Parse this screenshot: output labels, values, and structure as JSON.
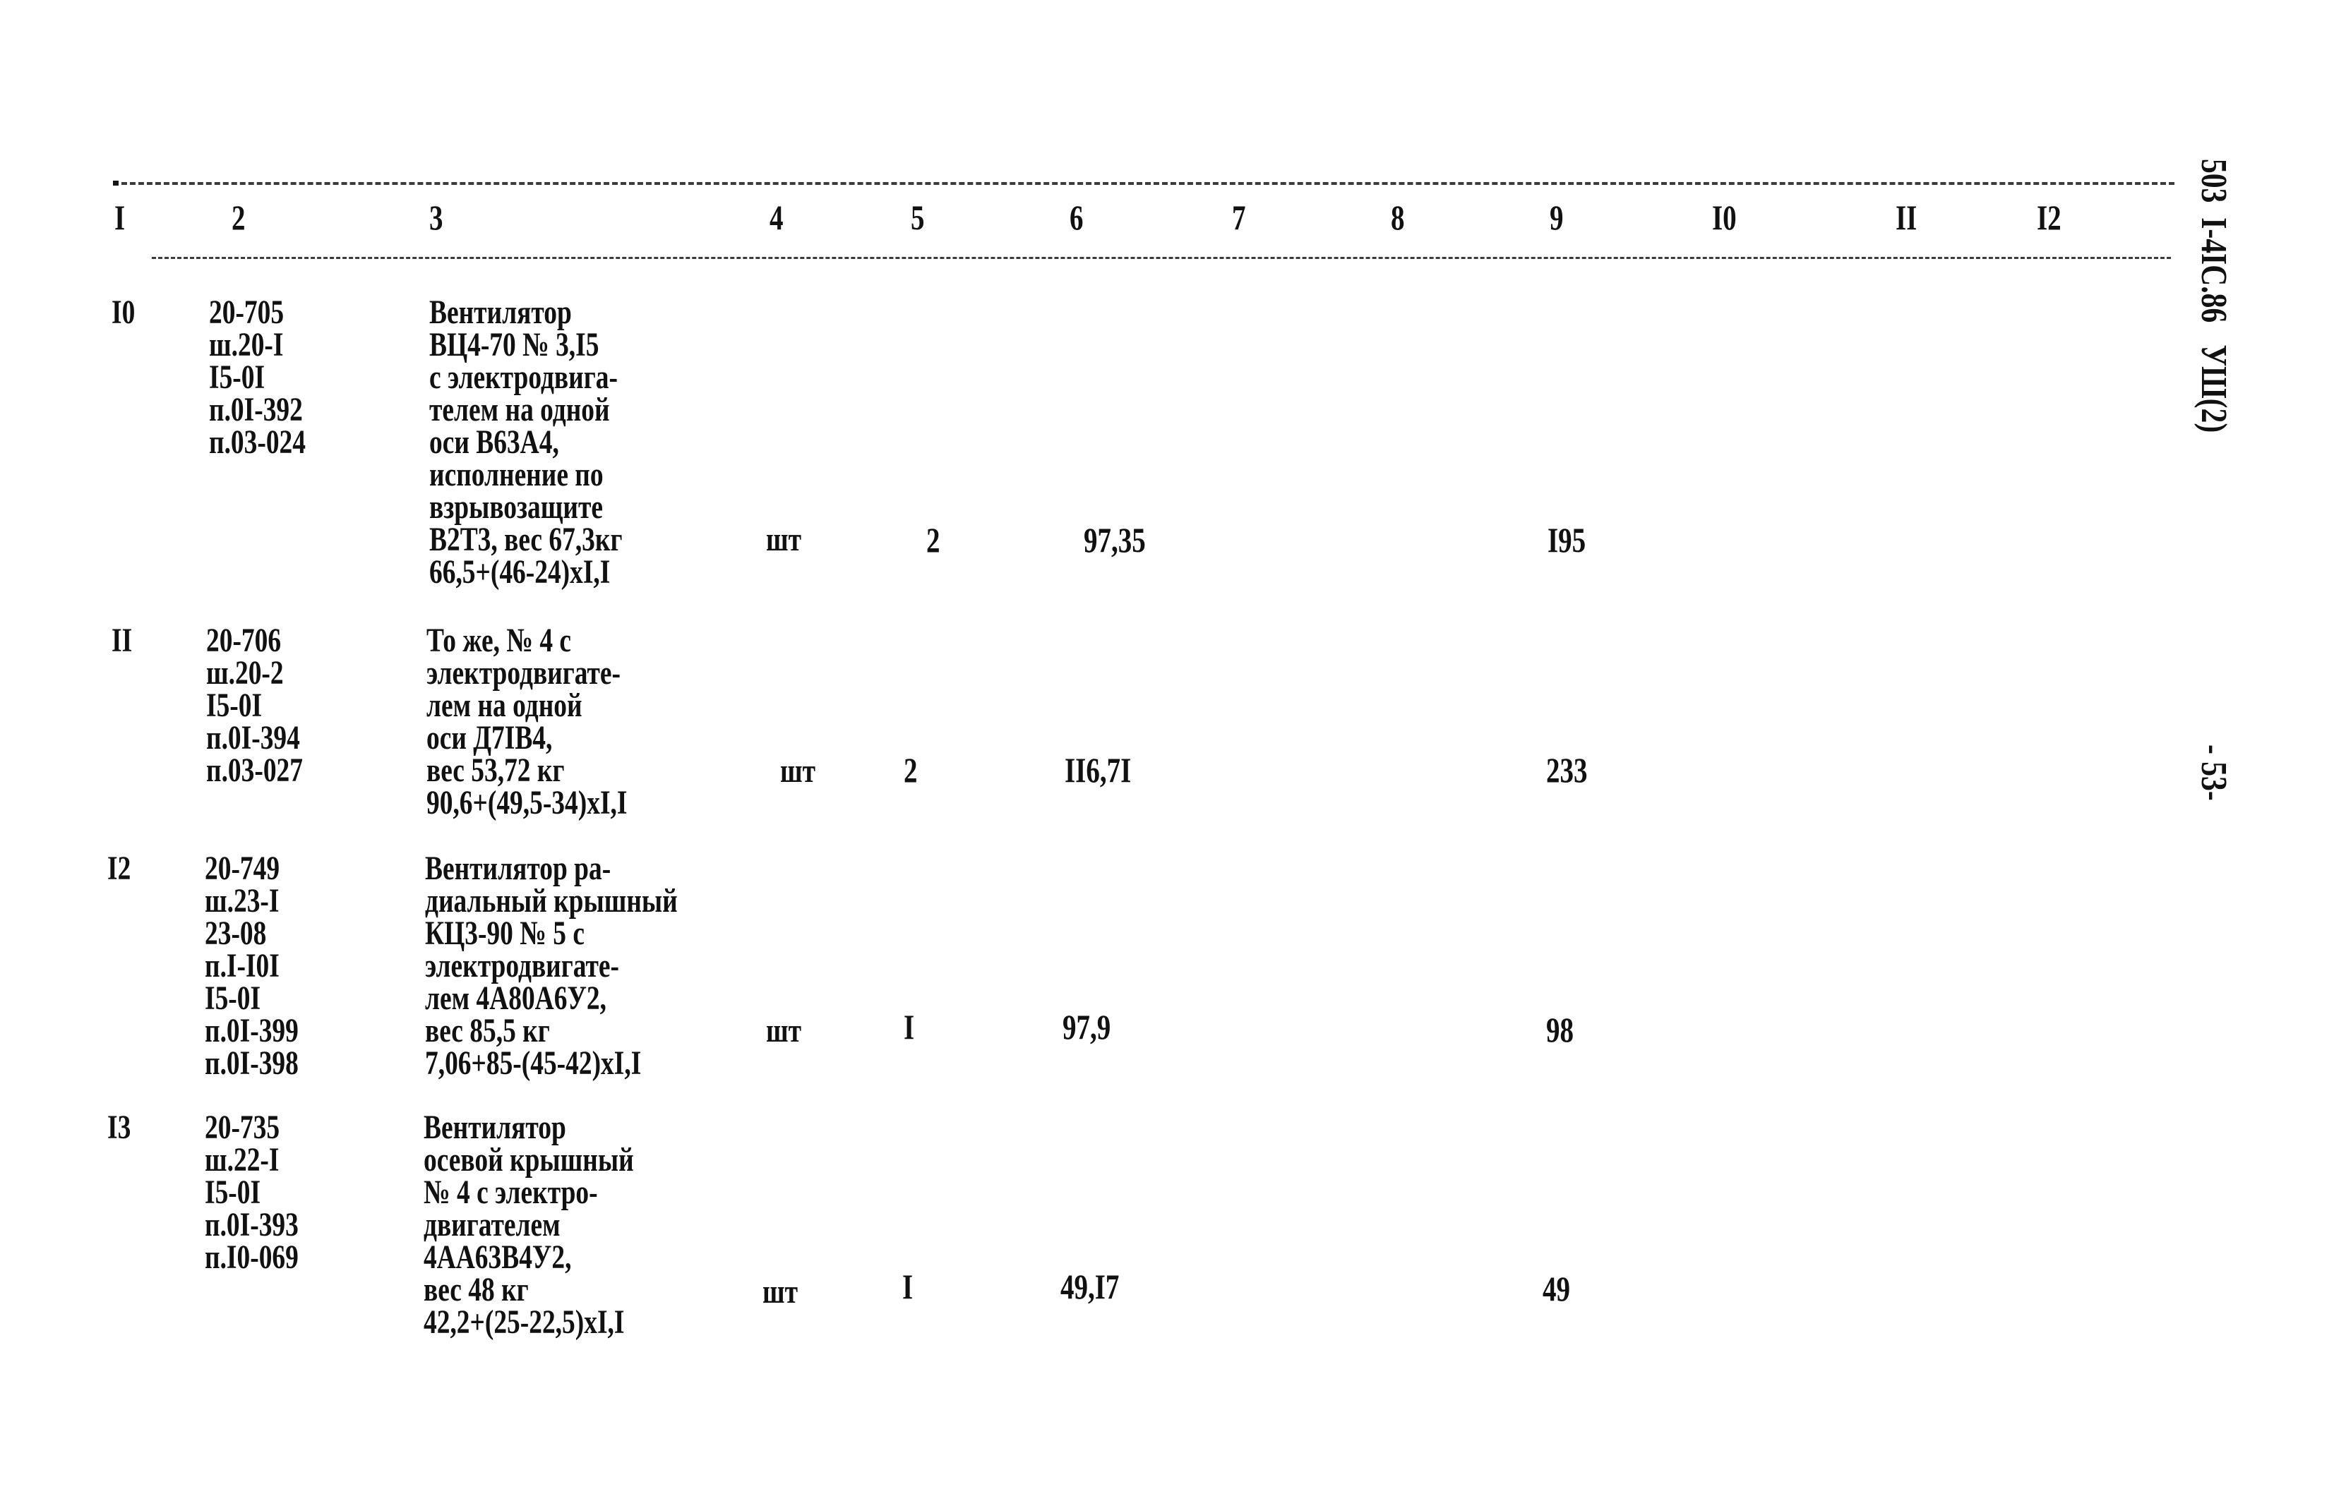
{
  "header": {
    "columns": [
      "I",
      "2",
      "3",
      "4",
      "5",
      "6",
      "7",
      "8",
      "9",
      "I0",
      "II",
      "I2"
    ]
  },
  "margin": {
    "code": "503  I-4IC.86   УШ(2)",
    "page": "- 53-"
  },
  "rows": [
    {
      "num": "I0",
      "codes": "20-705\nш.20-I\nI5-0I\nп.0I-392\nп.03-024",
      "description": "Вентилятор\nВЦ4-70 № 3,I5\nс электродвига-\nтелем на одной\nоси В63А4,\nисполнение по\nвзрывозащите\nВ2Т3, вес 67,3кг\n66,5+(46-24)xI,I",
      "unit": "шт",
      "qty": "2",
      "price": "97,35",
      "total": "I95"
    },
    {
      "num": "II",
      "codes": "20-706\nш.20-2\nI5-0I\nп.0I-394\nп.03-027",
      "description": "То же, № 4 с\nэлектродвигате-\nлем на одной\nоси Д7IВ4,\nвес 53,72 кг\n90,6+(49,5-34)xI,I",
      "unit": "шт",
      "qty": "2",
      "price": "II6,7I",
      "total": "233"
    },
    {
      "num": "I2",
      "codes": "20-749\nш.23-I\n23-08\nп.I-I0I\nI5-0I\nп.0I-399\nп.0I-398",
      "description": "Вентилятор ра-\nдиальный крышный\nКЦ3-90 № 5 с\nэлектродвигате-\nлем 4А80А6У2,\nвес 85,5 кг\n7,06+85-(45-42)xI,I",
      "unit": "шт",
      "qty": "I",
      "price": "97,9",
      "total": "98"
    },
    {
      "num": "I3",
      "codes": "20-735\nш.22-I\nI5-0I\nп.0I-393\nп.I0-069",
      "description": "Вентилятор\nосевой крышный\n№ 4 с электро-\nдвигателем\n4АА63В4У2,\nвес 48 кг\n42,2+(25-22,5)xI,I",
      "unit": "шт",
      "qty": "I",
      "price": "49,I7",
      "total": "49"
    }
  ]
}
